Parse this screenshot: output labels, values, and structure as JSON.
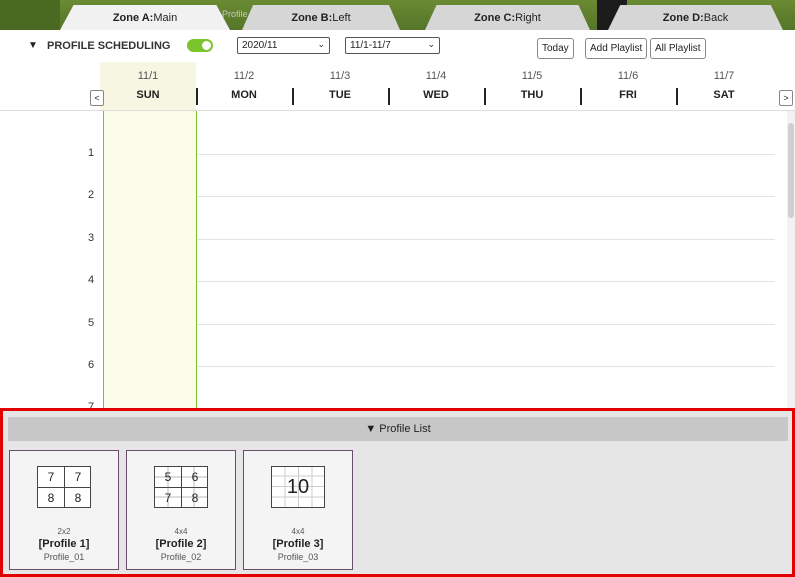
{
  "zones": [
    {
      "label": "Zone A:",
      "value": "Main"
    },
    {
      "label": "Zone B:",
      "value": "Left"
    },
    {
      "label": "Zone C:",
      "value": "Right"
    },
    {
      "label": "Zone D:",
      "value": "Back"
    }
  ],
  "zone_overlap_text": "Profile",
  "toolbar": {
    "title": "PROFILE SCHEDULING",
    "month_value": "2020/11",
    "week_value": "11/1-11/7",
    "today_label": "Today",
    "add_playlist_label": "Add Playlist",
    "all_playlist_label": "All Playlist"
  },
  "week": {
    "prev_label": "<",
    "next_label": ">",
    "days": [
      {
        "date": "11/1",
        "dow": "SUN"
      },
      {
        "date": "11/2",
        "dow": "MON"
      },
      {
        "date": "11/3",
        "dow": "TUE"
      },
      {
        "date": "11/4",
        "dow": "WED"
      },
      {
        "date": "11/5",
        "dow": "THU"
      },
      {
        "date": "11/6",
        "dow": "FRI"
      },
      {
        "date": "11/7",
        "dow": "SAT"
      }
    ]
  },
  "hours": [
    "1",
    "2",
    "3",
    "4",
    "5",
    "6",
    "7"
  ],
  "profile_list": {
    "title": "▼ Profile List",
    "profiles": [
      {
        "layout": "2x2",
        "name": "[Profile 1]",
        "file": "Profile_01",
        "cells": [
          "7",
          "7",
          "8",
          "8"
        ]
      },
      {
        "layout": "4x4",
        "name": "[Profile 2]",
        "file": "Profile_02",
        "cells": [
          "5",
          "6",
          "7",
          "8"
        ]
      },
      {
        "layout": "4x4",
        "name": "[Profile 3]",
        "file": "Profile_03",
        "cells": [
          "10"
        ]
      }
    ]
  },
  "colors": {
    "accent_green": "#7bc42c",
    "highlight_red": "#e30000",
    "today_column": "#fbfbe9"
  }
}
